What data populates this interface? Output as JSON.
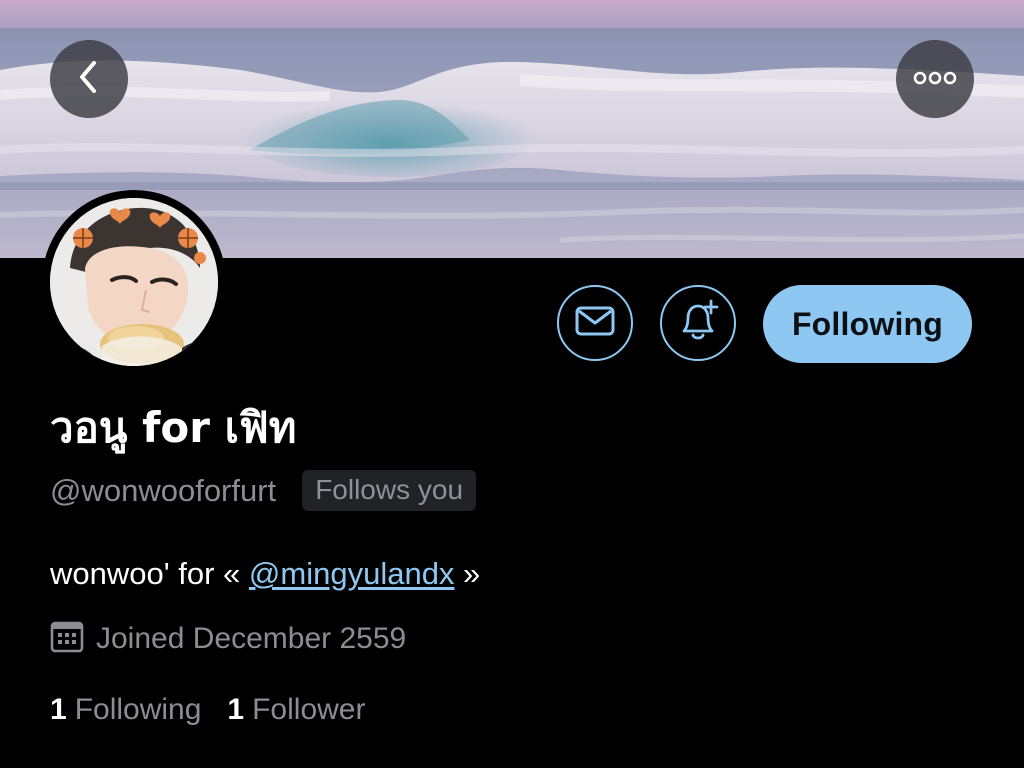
{
  "header": {
    "banner_description": "ocean wave photo"
  },
  "nav": {
    "back_icon": "chevron-left-icon",
    "more_icon": "more-horizontal-icon"
  },
  "actions": {
    "message_icon": "envelope-icon",
    "notify_icon": "bell-plus-icon",
    "following_label": "Following"
  },
  "profile": {
    "display_name": "วอนู for เฟิท",
    "handle": "@wonwooforfurt",
    "follows_you_label": "Follows you",
    "bio_prefix": "wonwoo' for « ",
    "bio_link": "@mingyulandx",
    "bio_suffix": " »",
    "joined": "Joined December 2559"
  },
  "stats": {
    "following_count": "1",
    "following_label": "Following",
    "followers_count": "1",
    "followers_label": "Follower"
  },
  "colors": {
    "accent": "#8ec8f2",
    "background": "#000000",
    "secondary_text": "#8a8e93",
    "badge_bg": "#202225"
  }
}
